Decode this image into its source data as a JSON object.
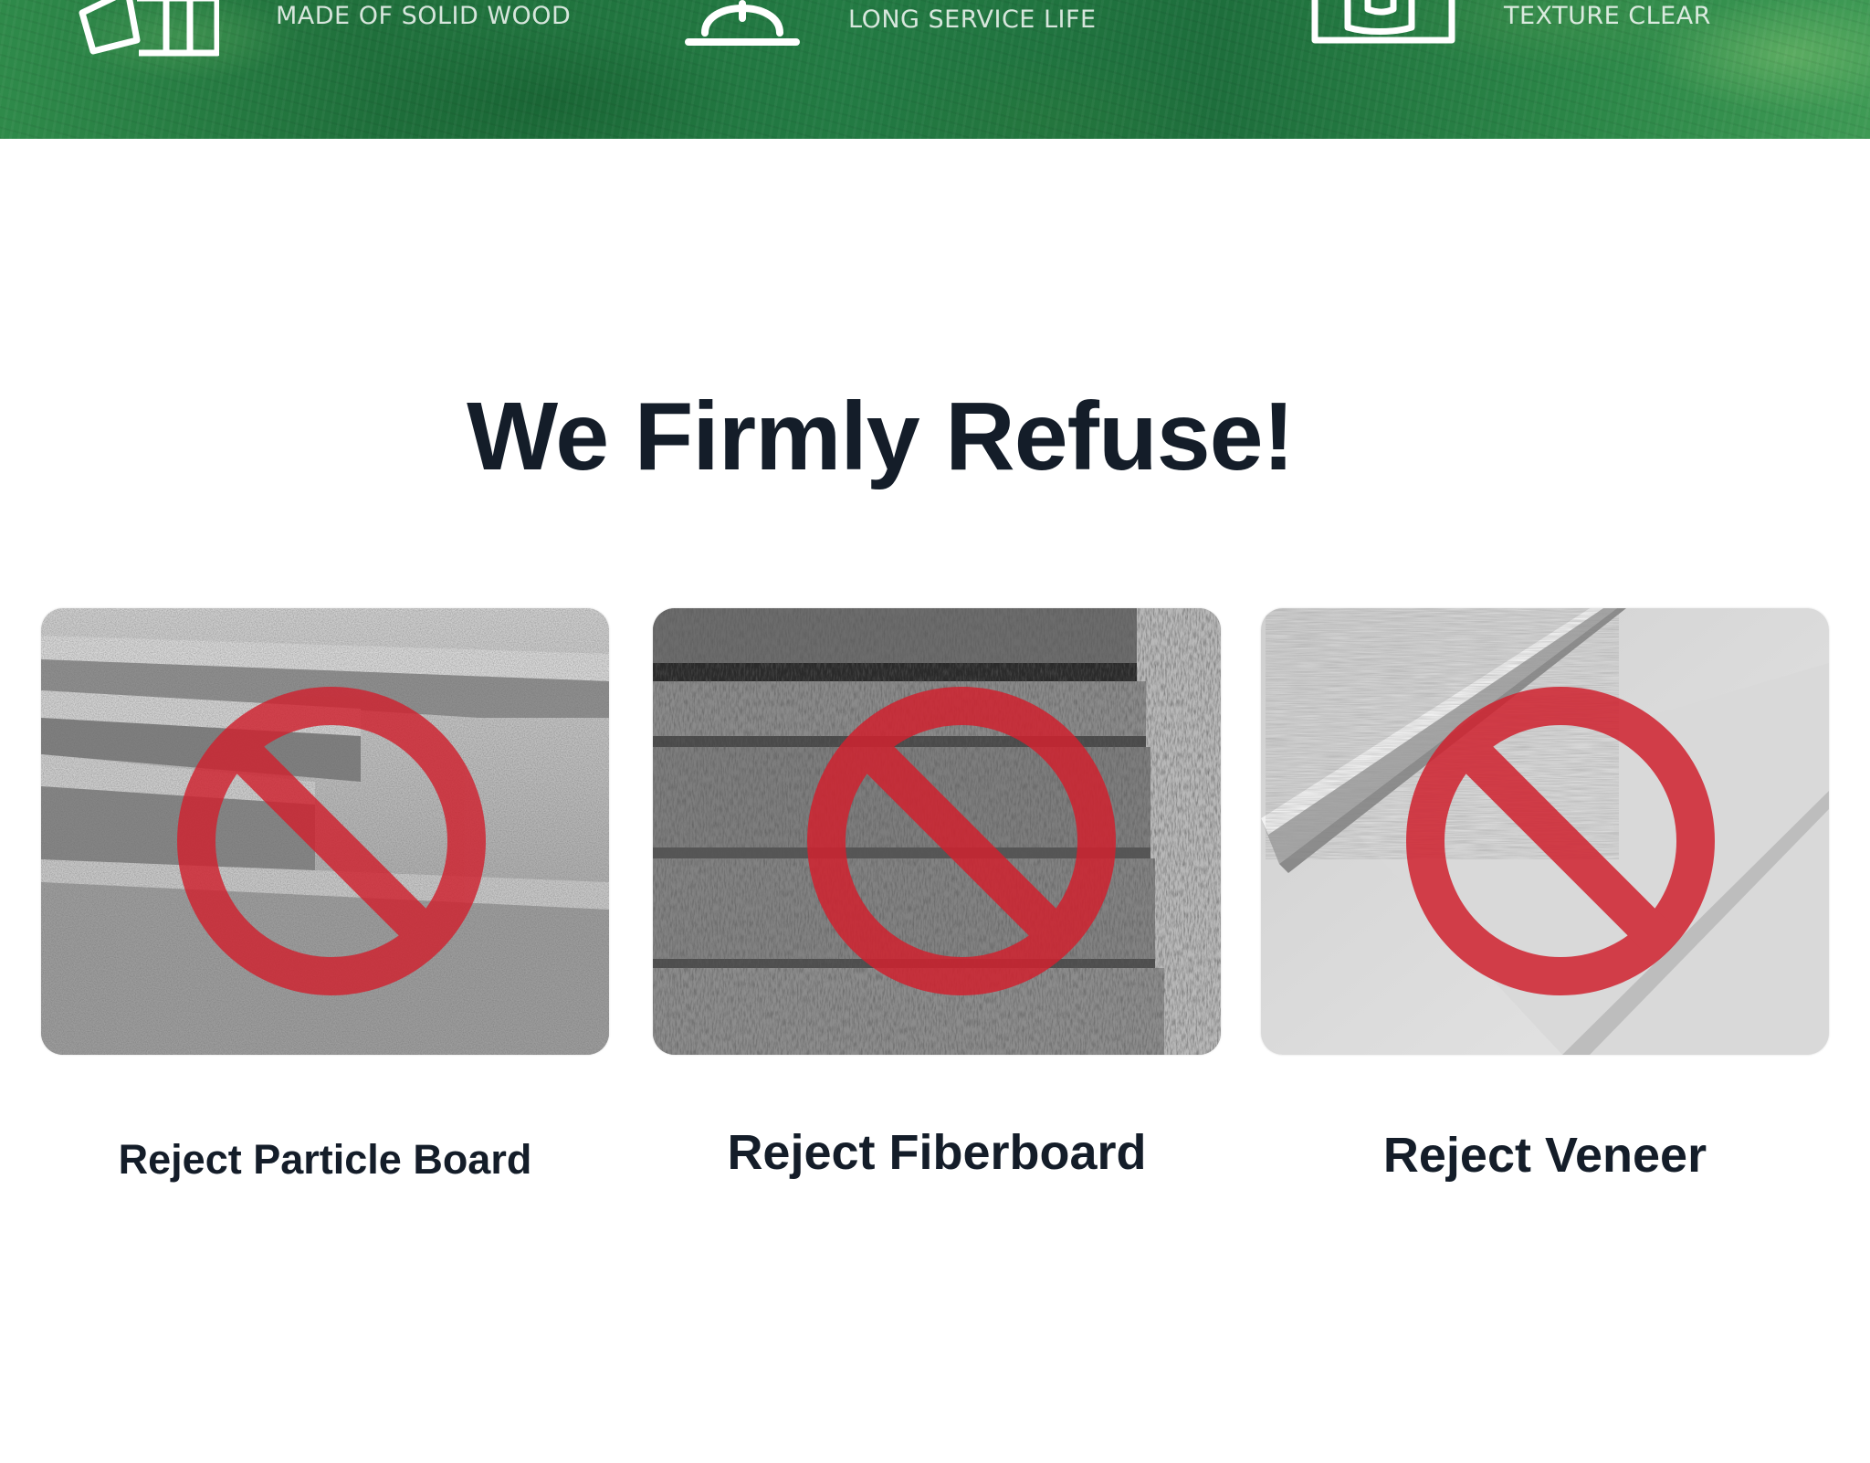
{
  "banner": {
    "features": [
      {
        "label": "MADE OF SOLID WOOD",
        "icon": "wood-board-icon"
      },
      {
        "label": "LONG SERVICE LIFE",
        "icon": "hard-hat-icon"
      },
      {
        "label": "TEXTURE CLEAR",
        "icon": "wood-grain-icon"
      }
    ]
  },
  "section": {
    "title": "We Firmly Refuse!"
  },
  "cards": [
    {
      "label": "Reject Particle Board",
      "icon": "prohibited-icon"
    },
    {
      "label": "Reject Fiberboard",
      "icon": "prohibited-icon"
    },
    {
      "label": "Reject Veneer",
      "icon": "prohibited-icon"
    }
  ],
  "colors": {
    "banner_green": "#1f6f3b",
    "heading_text": "#141d29",
    "prohibit_red": "#d0222f"
  }
}
